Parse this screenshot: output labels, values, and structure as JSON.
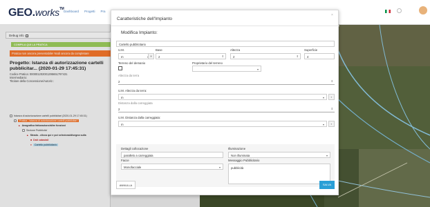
{
  "header": {
    "logo_main": "GEO.",
    "logo_italic": "works",
    "logo_tm": "TM",
    "nav": [
      "Dashboard",
      "Progetti",
      "Pra"
    ]
  },
  "left": {
    "debug_label": "Debug info",
    "compila_label": "COMPILA QUI LA PRATICA",
    "alert_text": "Pratica non ancora presentabile! Nodi ancora da completare",
    "project_title": "Progetto: Istanza di autorizzazione cartelli pubblicitar... (2020-01-29 17:45:31)",
    "codice": "Codice Pratica: 000001202001295651797431",
    "intermediario": "Intermediario:",
    "titolare": "Titolare della Concessione/Autoriz.:",
    "tree": [
      "Istanza di autorizzazione cartelli pubblicitari (2020-01-29 17:45:31)",
      "Pratica - Istanza di autorizzazione cartelli pubblicitari",
      "Anagrafica fatturazione/altre funzioni",
      "Sezione Pubblicita'",
      "Strada - clicca qui e poi seleziona/disegna sulla",
      "Dati catastali",
      "Cartello pubblicitario"
    ]
  },
  "modal": {
    "title": "Caratteristiche dell'Impianto",
    "close": "×",
    "subtitle": "Modifica Impianto:",
    "name_value": "Cartello pubblicitario",
    "um_label": "U.M.",
    "base_label": "Base",
    "altezza_label": "Altezza",
    "superficie_label": "Superficie",
    "um_value": "m",
    "base_value": "2",
    "altezza_value": "2",
    "superficie_value": "4",
    "terreno_demanio_label": "Terreno del demanio",
    "proprietario_label": "Proprietario del terreno",
    "altezza_terra_label": "Altezza da terra",
    "altezza_terra_value": "2",
    "um_altezza_terra_label": "U.M. Altezza da terra:",
    "um_altezza_terra_value": "m",
    "distanza_label": "Distanza dalla carreggiata",
    "distanza_value": "2",
    "um_distanza_label": "U.M. Distanza dalla carreggiata:",
    "um_distanza_value": "m",
    "dettagli_label": "Dettagli collocazione",
    "dettagli_value": "parallelo a carreggiata",
    "illuminazione_label": "Illuminazione",
    "illuminazione_value": "Non illuminata",
    "facce_label": "Facce",
    "facce_value": "Monofacciale",
    "messaggio_label": "Messaggio Pubblicitario",
    "messaggio_value": "pubblicità",
    "annulla": "ANNULLA",
    "salva": "SALVA"
  }
}
